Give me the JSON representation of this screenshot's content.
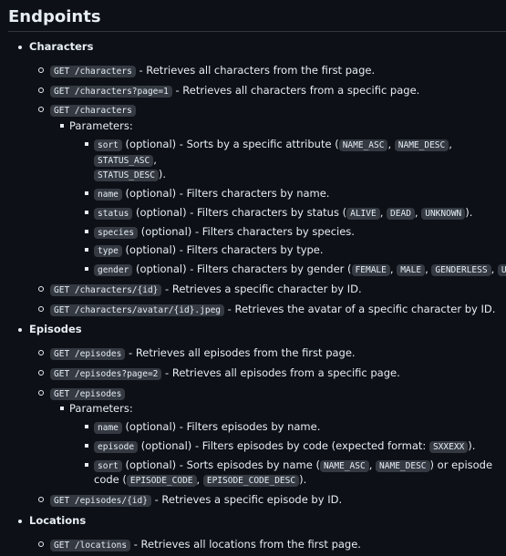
{
  "heading": "Endpoints",
  "characters": {
    "title": "Characters",
    "e1": {
      "code": "GET /characters",
      "desc": " - Retrieves all characters from the first page."
    },
    "e2": {
      "code": "GET /characters?page=1",
      "desc": " - Retrieves all characters from a specific page."
    },
    "e3": {
      "code": "GET /characters",
      "params_label": "Parameters:",
      "sort": {
        "code": "sort",
        "text1": " (optional) - Sorts by a specific attribute (",
        "v1": "NAME_ASC",
        "v2": "NAME_DESC",
        "v3": "STATUS_ASC",
        "v4": "STATUS_DESC",
        "end": ")."
      },
      "name": {
        "code": "name",
        "text": " (optional) - Filters characters by name."
      },
      "status": {
        "code": "status",
        "text1": " (optional) - Filters characters by status (",
        "v1": "ALIVE",
        "v2": "DEAD",
        "v3": "UNKNOWN",
        "end": ")."
      },
      "species": {
        "code": "species",
        "text": " (optional) - Filters characters by species."
      },
      "type": {
        "code": "type",
        "text": " (optional) - Filters characters by type."
      },
      "gender": {
        "code": "gender",
        "text1": " (optional) - Filters characters by gender (",
        "v1": "FEMALE",
        "v2": "MALE",
        "v3": "GENDERLESS",
        "v4": "UNKNOWN"
      }
    },
    "e4": {
      "code": "GET /characters/{id}",
      "desc": " - Retrieves a specific character by ID."
    },
    "e5": {
      "code": "GET /characters/avatar/{id}.jpeg",
      "desc": " - Retrieves the avatar of a specific character by ID."
    }
  },
  "episodes": {
    "title": "Episodes",
    "e1": {
      "code": "GET /episodes",
      "desc": " - Retrieves all episodes from the first page."
    },
    "e2": {
      "code": "GET /episodes?page=2",
      "desc": " - Retrieves all episodes from a specific page."
    },
    "e3": {
      "code": "GET /episodes",
      "params_label": "Parameters:",
      "name": {
        "code": "name",
        "text": " (optional) - Filters episodes by name."
      },
      "episode": {
        "code": "episode",
        "text1": " (optional) - Filters episodes by code (expected format: ",
        "v1": "SXXEXX",
        "end": ")."
      },
      "sort": {
        "code": "sort",
        "text1": " (optional) - Sorts episodes by name (",
        "v1": "NAME_ASC",
        "v2": "NAME_DESC",
        "text2": ") or episode code (",
        "v3": "EPISODE_CODE",
        "v4": "EPISODE_CODE_DESC",
        "end": ")."
      }
    },
    "e4": {
      "code": "GET /episodes/{id}",
      "desc": " - Retrieves a specific episode by ID."
    }
  },
  "locations": {
    "title": "Locations",
    "e1": {
      "code": "GET /locations",
      "desc": " - Retrieves all locations from the first page."
    }
  }
}
